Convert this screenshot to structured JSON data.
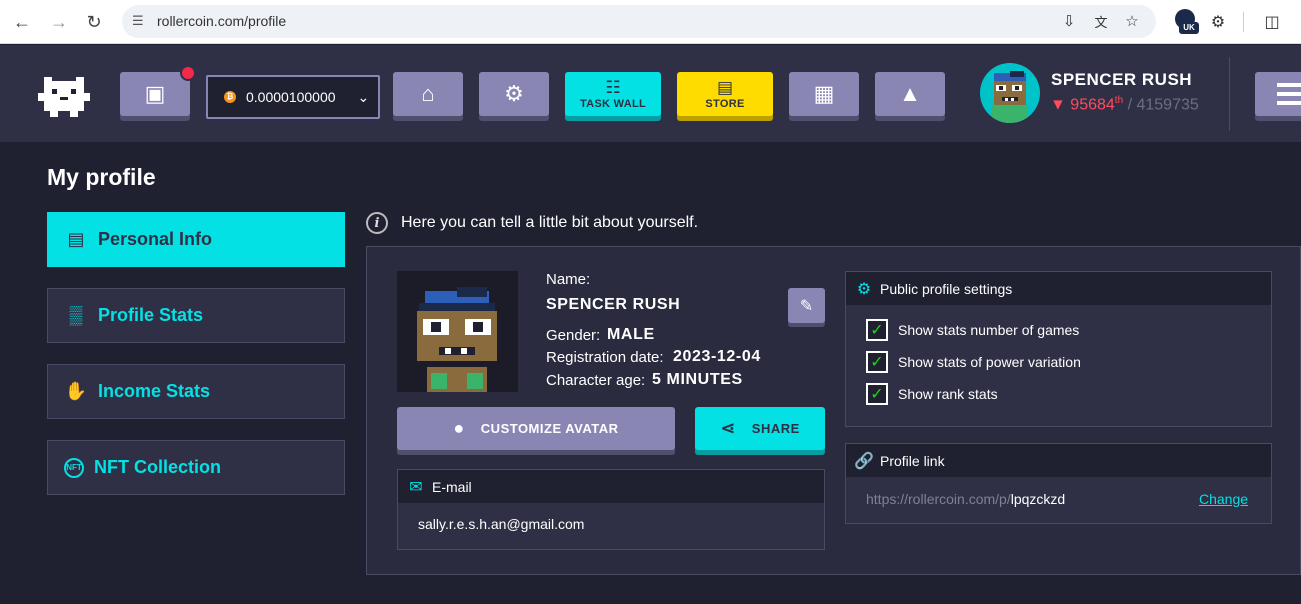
{
  "browser": {
    "url": "rollercoin.com/profile",
    "ext_badge": "UK"
  },
  "header": {
    "balance": "0.0000100000",
    "coin_symbol": "₿",
    "task_wall_label": "TASK WALL",
    "store_label": "STORE",
    "user_name": "SPENCER RUSH",
    "rank": "95684",
    "rank_suffix": "th",
    "rank_total": "/ 4159735",
    "colors": {
      "accent": "#03e1e4",
      "button": "#8a86b4",
      "store": "#ffdc00",
      "alert": "#f2294b"
    }
  },
  "page": {
    "title": "My profile",
    "info_text": "Here you can tell a little bit about yourself."
  },
  "sidebar": {
    "items": [
      {
        "label": "Personal Info",
        "icon": "id-card-icon"
      },
      {
        "label": "Profile Stats",
        "icon": "bar-chart-icon"
      },
      {
        "label": "Income Stats",
        "icon": "income-icon"
      },
      {
        "label": "NFT Collection",
        "icon": "nft-icon"
      }
    ]
  },
  "profile": {
    "name_label": "Name:",
    "name": "SPENCER RUSH",
    "gender_label": "Gender:",
    "gender": "MALE",
    "reg_label": "Registration date:",
    "reg_date": "2023-12-04",
    "age_label": "Character age:",
    "age": "5 MINUTES",
    "customize_label": "CUSTOMIZE AVATAR",
    "share_label": "SHARE",
    "email_title": "E-mail",
    "email": "sally.r.e.s.h.an@gmail.com"
  },
  "public_settings": {
    "title": "Public profile settings",
    "options": [
      {
        "label": "Show stats number of games",
        "checked": true
      },
      {
        "label": "Show stats of power variation",
        "checked": true
      },
      {
        "label": "Show rank stats",
        "checked": true
      }
    ]
  },
  "profile_link": {
    "title": "Profile link",
    "prefix": "https://rollercoin.com/p/",
    "code": "lpqzckzd",
    "change_label": "Change"
  }
}
